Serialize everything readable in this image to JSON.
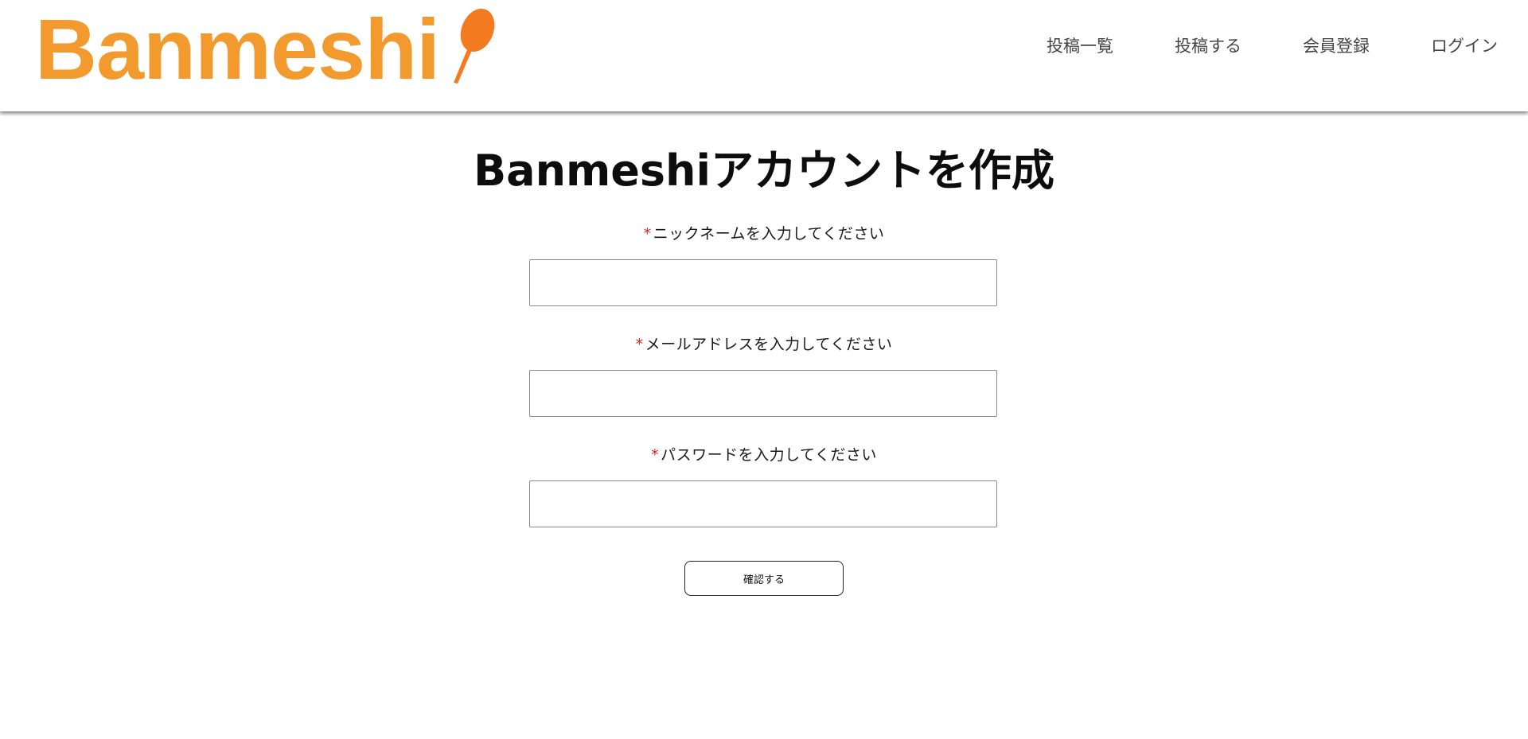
{
  "header": {
    "logo_text": "Banmeshi",
    "brand_color": "#f39a2e",
    "spoon_color": "#f47a20",
    "nav": [
      {
        "label": "投稿一覧"
      },
      {
        "label": "投稿する"
      },
      {
        "label": "会員登録"
      },
      {
        "label": "ログイン"
      }
    ]
  },
  "main": {
    "title": "Banmeshiアカウントを作成",
    "required_mark": "*",
    "fields": [
      {
        "label": "ニックネームを入力してください",
        "value": "",
        "placeholder": ""
      },
      {
        "label": "メールアドレスを入力してください",
        "value": "",
        "placeholder": ""
      },
      {
        "label": "パスワードを入力してください",
        "value": "",
        "placeholder": ""
      }
    ],
    "confirm_label": "確認する"
  }
}
